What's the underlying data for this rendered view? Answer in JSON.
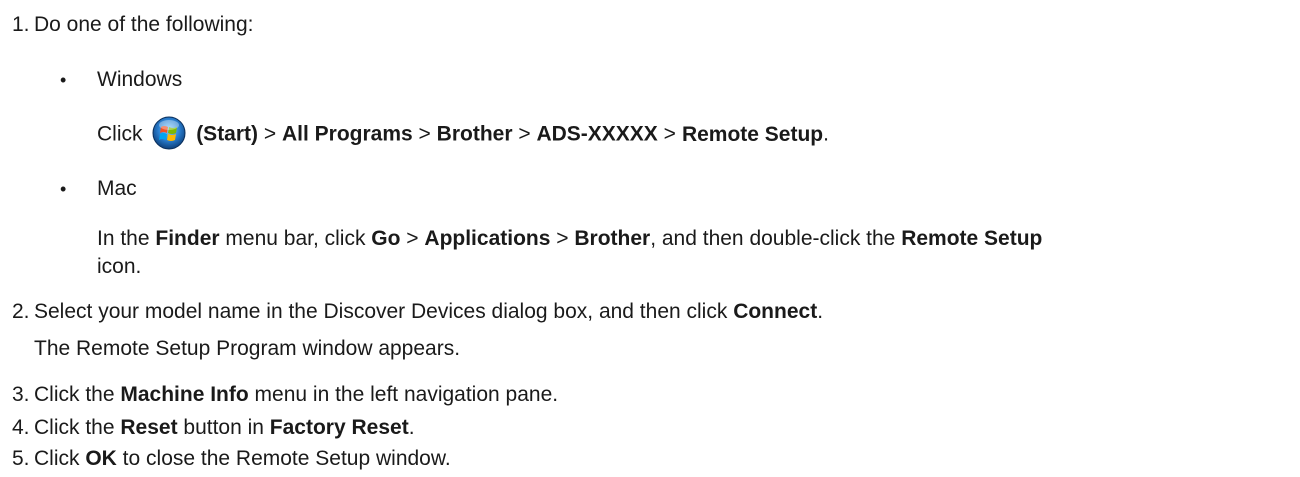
{
  "steps": [
    {
      "num": "1.",
      "text": "Do one of the following:"
    },
    {
      "num": "2.",
      "pre": "Select your model name in the Discover Devices dialog box, and then click ",
      "b1": "Connect",
      "post": ".",
      "note": "The Remote Setup Program window appears."
    },
    {
      "num": "3.",
      "pre": "Click the ",
      "b1": "Machine Info",
      "post": " menu in the left navigation pane."
    },
    {
      "num": "4.",
      "pre": "Click the ",
      "b1": "Reset",
      "mid": " button in ",
      "b2": "Factory Reset",
      "post": "."
    },
    {
      "num": "5.",
      "pre": "Click ",
      "b1": "OK",
      "post": " to close the Remote Setup window."
    }
  ],
  "windows": {
    "bullet": "•",
    "label": "Windows",
    "click": "Click",
    "start": "(Start)",
    "sep": ">",
    "p1": "All Programs",
    "p2": "Brother",
    "p3": "ADS-XXXXX",
    "p4": "Remote Setup",
    "end": "."
  },
  "mac": {
    "bullet": "•",
    "label": "Mac",
    "s1": "In the ",
    "b1": "Finder",
    "s2": " menu bar, click ",
    "b2": "Go",
    "s3": " > ",
    "b3": "Applications",
    "s4": " > ",
    "b4": "Brother",
    "s5": ", and then double-click the ",
    "b5": "Remote Setup",
    "line2": "icon."
  }
}
